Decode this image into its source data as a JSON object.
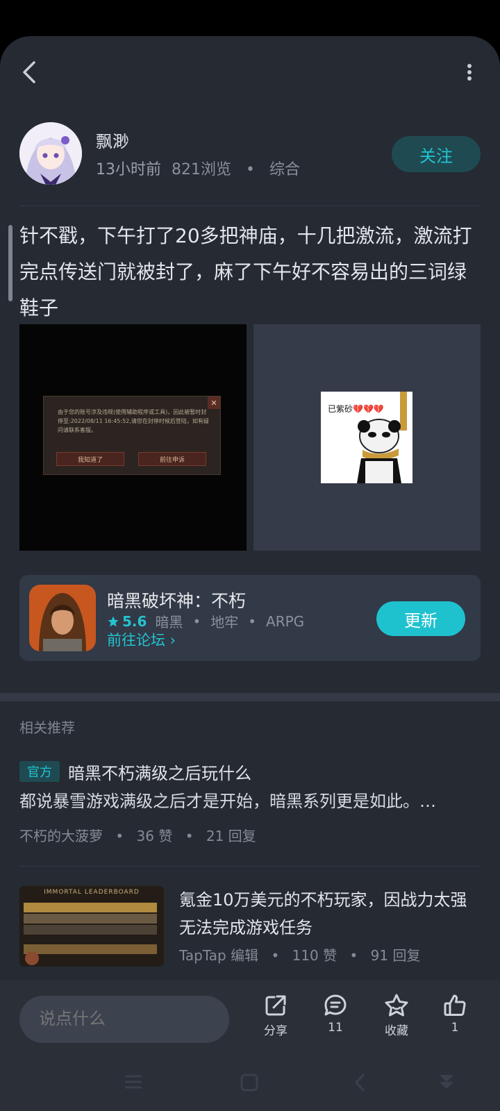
{
  "author": {
    "name": "飘渺",
    "time": "13小时前",
    "views": "821浏览",
    "category": "综合",
    "follow_label": "关注"
  },
  "post": {
    "body": "针不戳，下午打了20多把神庙，十几把激流，激流打完点传送门就被封了，麻了下午好不容易出的三词绿鞋子",
    "image_dialog": {
      "text": "由于您的账号涉及违规(使用辅助程序或工具)，因此被暂时封停至:2022/08/11 16:45:52,请您在封停时候后登陆，如有疑问请联系客服。",
      "btn_ok": "我知道了",
      "btn_appeal": "前往申诉",
      "close": "✕"
    },
    "meme_text": "已紫砂💔💔💔"
  },
  "game": {
    "title": "暗黑破坏神：不朽",
    "rating": "5.6",
    "tags": [
      "暗黑",
      "地牢",
      "ARPG"
    ],
    "forum_link": "前往论坛 ›",
    "update_label": "更新"
  },
  "related": {
    "heading": "相关推荐",
    "items": [
      {
        "badge": "官方",
        "title": "暗黑不朽满级之后玩什么",
        "excerpt": "都说暴雪游戏满级之后才是开始，暗黑系列更是如此。…",
        "author": "不朽的大菠萝",
        "likes": "36 赞",
        "replies": "21 回复"
      },
      {
        "title": "氪金10万美元的不朽玩家，因战力太强无法完成游戏任务",
        "author": "TapTap 编辑",
        "likes": "110 赞",
        "replies": "91 回复",
        "thumb_text": "IMMORTAL LEADERBOARD"
      }
    ]
  },
  "actions": {
    "comment_placeholder": "说点什么",
    "share": "分享",
    "comments": "11",
    "favorite": "收藏",
    "likes": "1"
  },
  "colors": {
    "accent": "#22c4d0",
    "background": "#252a33",
    "card": "#323947"
  }
}
